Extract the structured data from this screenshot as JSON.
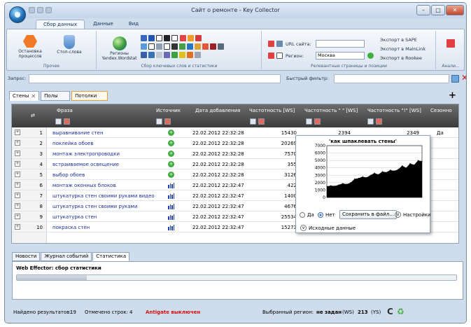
{
  "window": {
    "title": "Сайт о ремонте - Key Collector"
  },
  "menu_tabs": [
    "Сбор данных",
    "Данные",
    "Вид"
  ],
  "ribbon": {
    "group_prochee": {
      "label": "Прочее",
      "stop_processes": "Остановка процессов",
      "stop_words": "Стоп-слова"
    },
    "group_sbor": {
      "label": "Сбор ключевых слов и статистики",
      "regions": "Регионы Yandex.Wordstat"
    },
    "group_relevant": {
      "label": "Релевантные страницы и позиции",
      "url_label": "URL сайта:",
      "region_label": "Регион:",
      "region_value": "Москва",
      "export_sape": "Экспорт в SAPE",
      "export_mainlink": "Экспорт в MainLink",
      "export_rookee": "Экспорт в Rookee"
    },
    "group_anal": {
      "label": "Анали..."
    }
  },
  "query_bar": {
    "query_label": "Запрос:",
    "filter_label": "Быстрый фильтр:"
  },
  "doc_tabs": [
    "Стены",
    "Полы",
    "Потолки"
  ],
  "grid": {
    "headers": {
      "phrase": "Фраза",
      "source": "Источник",
      "date": "Дата добавления",
      "freq_ws": "Частотность [WS]",
      "freq_quote": "Частотность \" \" [WS]",
      "freq_excl": "Частотность \"!\" [WS]",
      "season": "Сезонно"
    },
    "rows": [
      {
        "num": "1",
        "phrase": "выравнивание стен",
        "source": "google",
        "date": "22.02.2012 22:32:28",
        "f1": "15430",
        "f2": "2394",
        "f3": "2349",
        "season": "Да"
      },
      {
        "num": "2",
        "phrase": "поклейка обоев",
        "source": "google",
        "date": "22.02.2012 22:32:28",
        "f1": "20269",
        "f2": "",
        "f3": "",
        "season": ""
      },
      {
        "num": "3",
        "phrase": "монтаж электропроводки",
        "source": "google",
        "date": "22.02.2012 22:32:28",
        "f1": "7570",
        "f2": "",
        "f3": "",
        "season": ""
      },
      {
        "num": "4",
        "phrase": "встраиваемое освещение",
        "source": "google",
        "date": "22.02.2012 22:32:28",
        "f1": "355",
        "f2": "",
        "f3": "",
        "season": ""
      },
      {
        "num": "5",
        "phrase": "выбор обоев",
        "source": "google",
        "date": "22.02.2012 22:32:28",
        "f1": "3126",
        "f2": "",
        "f3": "",
        "season": ""
      },
      {
        "num": "6",
        "phrase": "монтаж оконных блоков",
        "source": "yandex",
        "date": "22.02.2012 22:32:47",
        "f1": "422",
        "f2": "",
        "f3": "",
        "season": ""
      },
      {
        "num": "7",
        "phrase": "штукатурка стен своими руками видео",
        "source": "yandex",
        "date": "22.02.2012 22:32:47",
        "f1": "1400",
        "f2": "",
        "f3": "",
        "season": ""
      },
      {
        "num": "8",
        "phrase": "штукатурка стен своими руками",
        "source": "yandex",
        "date": "22.02.2012 22:32:47",
        "f1": "4676",
        "f2": "",
        "f3": "",
        "season": ""
      },
      {
        "num": "9",
        "phrase": "штукатурка стен",
        "source": "yandex",
        "date": "22.02.2012 22:32:47",
        "f1": "25534",
        "f2": "",
        "f3": "",
        "season": ""
      },
      {
        "num": "10",
        "phrase": "покраска стен",
        "source": "yandex",
        "date": "22.02.2012 22:32:47",
        "f1": "15273",
        "f2": "",
        "f3": "",
        "season": ""
      }
    ]
  },
  "popup": {
    "opt_yes": "Да",
    "opt_no": "Нет",
    "save_btn": "Сохранить в файл...",
    "settings": "Настройки",
    "source_data": "Исходные данные"
  },
  "chart_data": {
    "type": "area",
    "title": "'как шпаклевать стены'",
    "ylim": [
      0,
      7000
    ],
    "yticks": [
      0,
      1000,
      2000,
      3000,
      4000,
      5000,
      6000,
      7000
    ],
    "x": [
      1,
      2,
      3,
      4,
      5,
      6,
      7,
      8,
      9,
      10,
      11,
      12,
      13,
      14,
      15,
      16,
      17,
      18,
      19,
      20,
      21,
      22,
      23,
      24,
      25
    ],
    "values": [
      1500,
      1600,
      1550,
      1700,
      1900,
      1800,
      2000,
      2500,
      2600,
      2800,
      2700,
      3000,
      3300,
      3100,
      3500,
      3400,
      3700,
      3600,
      3800,
      4300,
      4000,
      4600,
      4400,
      5000,
      4900
    ]
  },
  "bottom_tabs": [
    "Новости",
    "Журнал событий",
    "Статистика"
  ],
  "stats_panel": {
    "label": "Web Effector: сбор статистики",
    "progress": 0.16
  },
  "statusbar": {
    "found_label": "Найдено результатов:",
    "found_value": "19",
    "marked_label": "Отмечено строк:",
    "marked_value": "4",
    "antigate": "Antigate выключен",
    "region_label": "Выбранный регион:",
    "region_value": "не задан",
    "region_ws": "(WS)",
    "region_num": "213",
    "region_ys": "(YS)"
  }
}
